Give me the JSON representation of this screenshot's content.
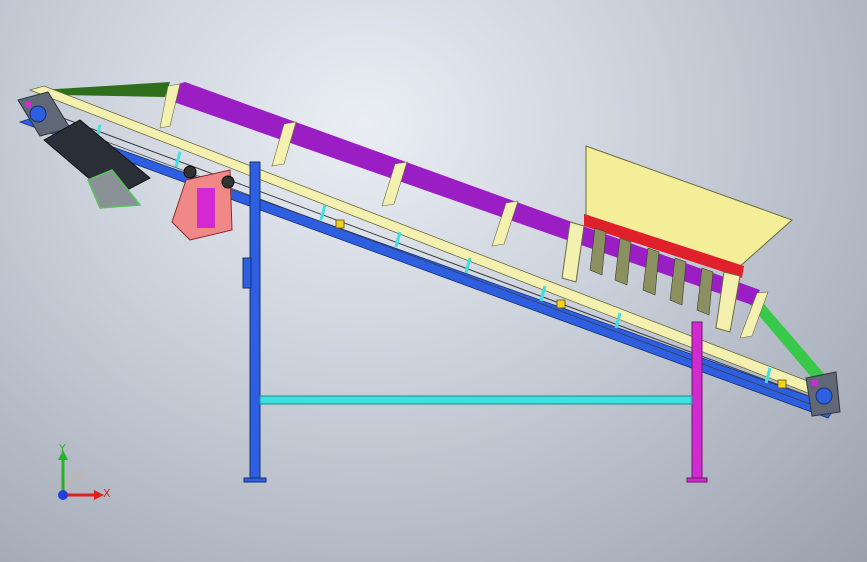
{
  "viewport": {
    "background_top": "#eaeef4",
    "background_bottom": "#9aa1ad"
  },
  "model": {
    "parts": [
      "conveyor-frame",
      "top-rail",
      "bottom-rail",
      "purple-top-beam",
      "feed-hopper",
      "drive-motor",
      "gearbox",
      "support-leg-left",
      "support-leg-right",
      "cross-brace",
      "head-pulley",
      "tail-pulley",
      "tension-cable-left",
      "tension-cable-right"
    ],
    "colors": {
      "top_rail": "#f4f0b0",
      "bottom_rail": "#2d5fe0",
      "beam": "#9a1ec4",
      "hopper": "#f4ee98",
      "hopper_rim": "#e0202a",
      "motor": "#f08888",
      "leg_left": "#2d5fe0",
      "leg_right": "#d22ad0",
      "brace": "#3ee0e0",
      "cable_left": "#2f6f1c",
      "cable_right": "#38c84a"
    }
  },
  "triad": {
    "x_label": "X",
    "y_label": "Y",
    "x_color": "#e02020",
    "y_color": "#28b030",
    "z_color": "#2040e0"
  }
}
